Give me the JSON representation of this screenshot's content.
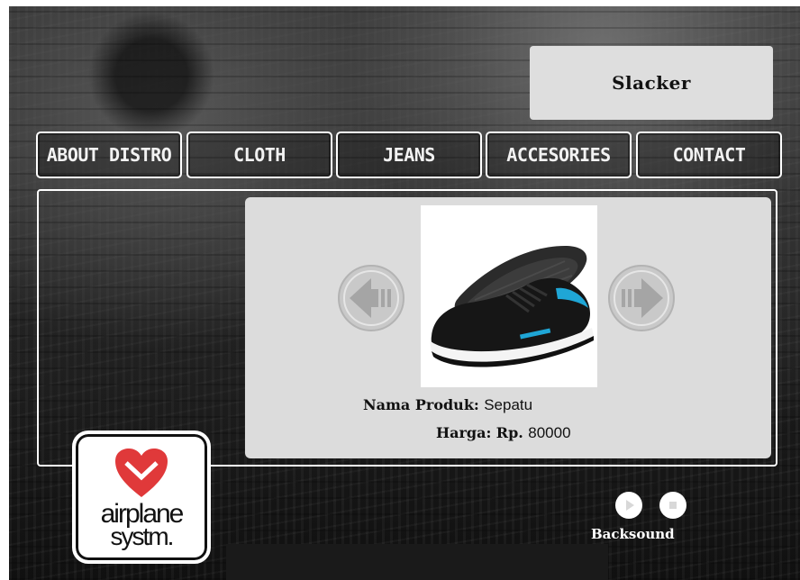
{
  "brand": {
    "title": "Slacker"
  },
  "nav": {
    "items": [
      {
        "label": "ABOUT DISTRO"
      },
      {
        "label": "CLOTH"
      },
      {
        "label": "JEANS"
      },
      {
        "label": "ACCESORIES"
      },
      {
        "label": "CONTACT"
      }
    ]
  },
  "product": {
    "name_label": "Nama Produk:",
    "name_value": "Sepatu",
    "price_label": "Harga:",
    "price_currency": "Rp.",
    "price_value": "80000",
    "image_icon": "sneaker-image"
  },
  "slider": {
    "prev_icon": "arrow-left-icon",
    "next_icon": "arrow-right-icon"
  },
  "logo": {
    "line1": "airplane",
    "line2": "systm.",
    "mark_icon": "heart-chevron-icon",
    "mark_color": "#e0393a"
  },
  "player": {
    "play_icon": "play-icon",
    "stop_icon": "stop-icon",
    "label": "Backsound"
  }
}
